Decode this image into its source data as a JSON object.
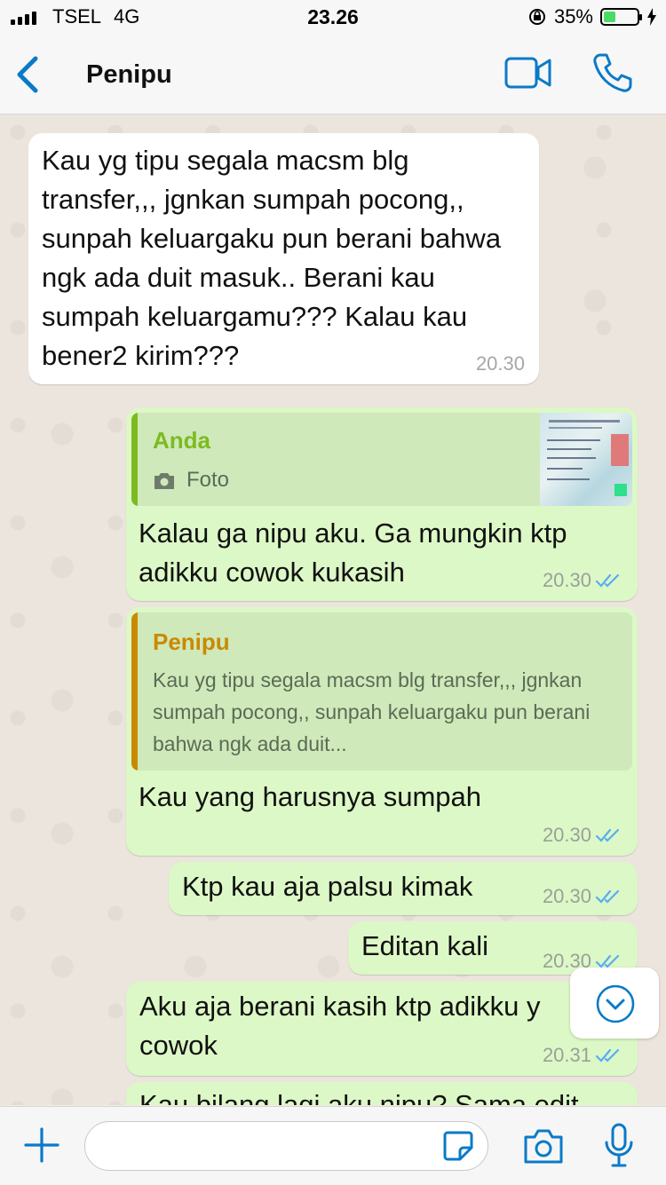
{
  "status_bar": {
    "carrier": "TSEL",
    "network": "4G",
    "time": "23.26",
    "battery_percent": "35%",
    "battery_level": 0.35
  },
  "nav": {
    "title": "Penipu",
    "back_icon": "chevron-left-icon",
    "video_icon": "video-call-icon",
    "call_icon": "phone-icon"
  },
  "messages": [
    {
      "direction": "in",
      "text": "Kau yg tipu segala macsm blg transfer,,, jgnkan sumpah pocong,, sunpah keluargaku pun berani bahwa ngk ada duit masuk..  Berani kau sumpah keluargamu???  Kalau kau bener2 kirim???",
      "time": "20.30"
    },
    {
      "direction": "out",
      "quote": {
        "name": "Anda",
        "text": "Foto",
        "icon": "camera-icon",
        "thumb": "ktp-thumbnail"
      },
      "text": "Kalau ga nipu aku. Ga mungkin ktp adikku cowok kukasih",
      "time": "20.30"
    },
    {
      "direction": "out",
      "quote": {
        "name": "Penipu",
        "text": "Kau yg tipu segala macsm blg transfer,,, jgnkan sumpah pocong,,  sunpah keluargaku pun berani bahwa ngk ada duit..."
      },
      "text": "Kau yang harusnya sumpah",
      "time": "20.30"
    },
    {
      "direction": "out",
      "text": "Ktp kau aja palsu kimak",
      "time": "20.30"
    },
    {
      "direction": "out",
      "text": "Editan kali",
      "time": "20.30"
    },
    {
      "direction": "out",
      "text": "Aku aja berani kasih ktp adikku y cowok",
      "time": "20.31"
    },
    {
      "direction": "out",
      "text": "Kau bilang lagi aku nipu? Sama edit",
      "time": ""
    }
  ],
  "colors": {
    "incoming_bubble": "#ffffff",
    "outgoing_bubble": "#dcf8c6",
    "accent": "#0a7ac8",
    "quote_me": "#7cbb1f",
    "quote_other": "#c98a00",
    "tick_blue": "#58aef0"
  },
  "input_bar": {
    "plus_icon": "plus-icon",
    "sticker_icon": "sticker-icon",
    "camera_icon": "camera-icon",
    "mic_icon": "microphone-icon"
  }
}
